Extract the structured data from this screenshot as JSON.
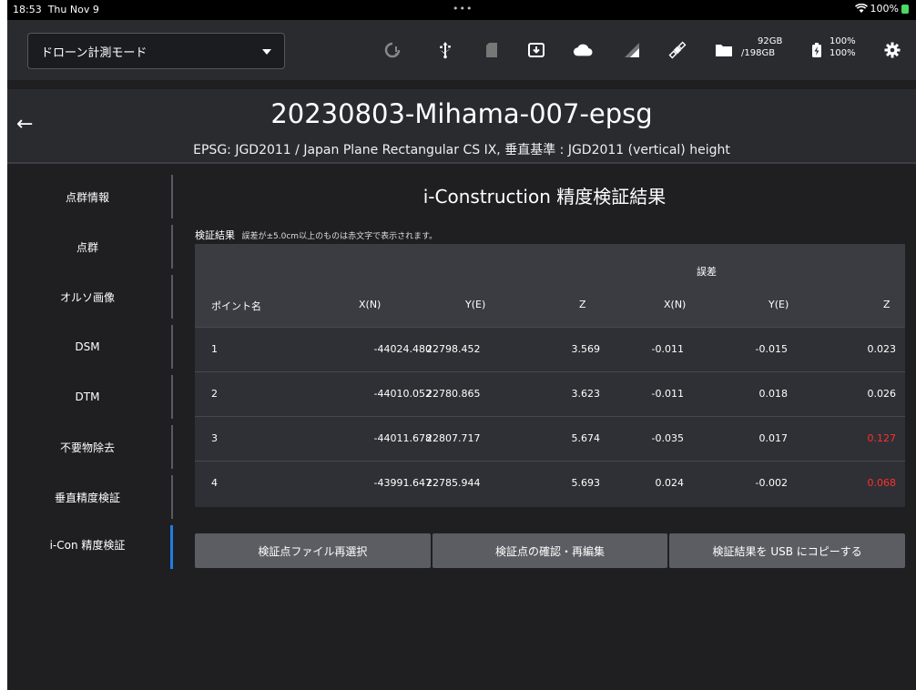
{
  "status_bar": {
    "time": "18:53",
    "date": "Thu Nov 9",
    "dots": "•••",
    "wifi_icon": "wifi-icon",
    "battery": "100%"
  },
  "toolbar": {
    "mode": "ドローン計測モード",
    "storage_used": "92GB",
    "storage_total": "/198GB",
    "battery_1": "100%",
    "battery_2": "100%",
    "icons": [
      "gps-signal-icon",
      "usb-icon",
      "sd-card-icon",
      "download-icon",
      "cloud-icon",
      "signal-icon",
      "satellite-icon",
      "folder-icon",
      "battery-charging-icon",
      "gear-icon"
    ]
  },
  "header": {
    "title": "20230803-Mihama-007-epsg",
    "subtitle": "EPSG: JGD2011 / Japan Plane Rectangular CS IX, 垂直基準 : JGD2011 (vertical) height"
  },
  "sidebar": {
    "items": [
      {
        "label": "点群情報"
      },
      {
        "label": "点群"
      },
      {
        "label": "オルソ画像"
      },
      {
        "label": "DSM"
      },
      {
        "label": "DTM"
      },
      {
        "label": "不要物除去"
      },
      {
        "label": "垂直精度検証"
      },
      {
        "label": "i-Con 精度検証"
      }
    ],
    "active_index": 7
  },
  "main": {
    "section_title": "i-Construction 精度検証結果",
    "result_label": "検証結果",
    "result_note": "誤差が±5.0cm以上のものは赤文字で表示されます。",
    "table": {
      "group_header": "誤差",
      "columns": [
        "ポイント名",
        "X(N)",
        "Y(E)",
        "Z",
        "X(N)",
        "Y(E)",
        "Z"
      ],
      "rows": [
        {
          "name": "1",
          "x": "-44024.480",
          "y": "22798.452",
          "z": "3.569",
          "ex": "-0.011",
          "ey": "-0.015",
          "ez": "0.023",
          "ez_red": false
        },
        {
          "name": "2",
          "x": "-44010.052",
          "y": "22780.865",
          "z": "3.623",
          "ex": "-0.011",
          "ey": "0.018",
          "ez": "0.026",
          "ez_red": false
        },
        {
          "name": "3",
          "x": "-44011.678",
          "y": "22807.717",
          "z": "5.674",
          "ex": "-0.035",
          "ey": "0.017",
          "ez": "0.127",
          "ez_red": true
        },
        {
          "name": "4",
          "x": "-43991.647",
          "y": "22785.944",
          "z": "5.693",
          "ex": "0.024",
          "ey": "-0.002",
          "ez": "0.068",
          "ez_red": true
        }
      ]
    },
    "buttons": {
      "reselect": "検証点ファイル再選択",
      "edit": "検証点の確認・再編集",
      "copy_usb": "検証結果を USB にコピーする"
    }
  },
  "colors": {
    "background": "#1f1f22",
    "accent": "#1e7ee0",
    "error_red": "#ff2f2f"
  }
}
